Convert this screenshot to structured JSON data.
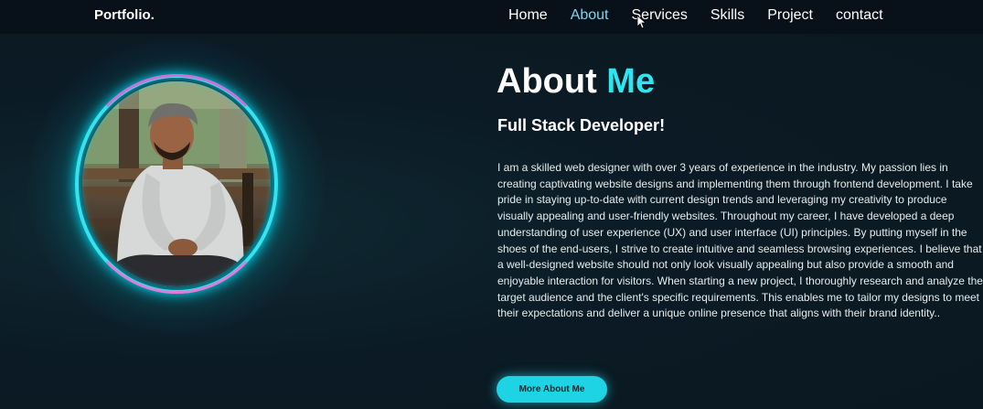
{
  "nav": {
    "logo": "Portfolio.",
    "links": [
      "Home",
      "About",
      "Services",
      "Skills",
      "Project",
      "contact"
    ],
    "active": "About"
  },
  "about": {
    "title_white": "About",
    "title_accent": "Me",
    "subtitle": "Full Stack Developer!",
    "bio": "I am a skilled web designer with over 3 years of experience in the industry. My passion lies in creating captivating website designs and implementing them through frontend development. I take pride in staying up-to-date with current design trends and leveraging my creativity to produce visually appealing and user-friendly websites. Throughout my career, I have developed a deep understanding of user experience (UX) and user interface (UI) principles. By putting myself in the shoes of the end-users, I strive to create intuitive and seamless browsing experiences. I believe that a well-designed website should not only look visually appealing but also provide a smooth and enjoyable interaction for visitors. When starting a new project, I thoroughly research and analyze the target audience and the client's specific requirements. This enables me to tailor my designs to meet their expectations and deliver a unique online presence that aligns with their brand identity..",
    "button": "More About Me"
  },
  "colors": {
    "accent": "#2ee6f0",
    "nav_active": "#7dd6f0",
    "background": "#0b1a24",
    "ring_pink": "#e45fd7"
  }
}
